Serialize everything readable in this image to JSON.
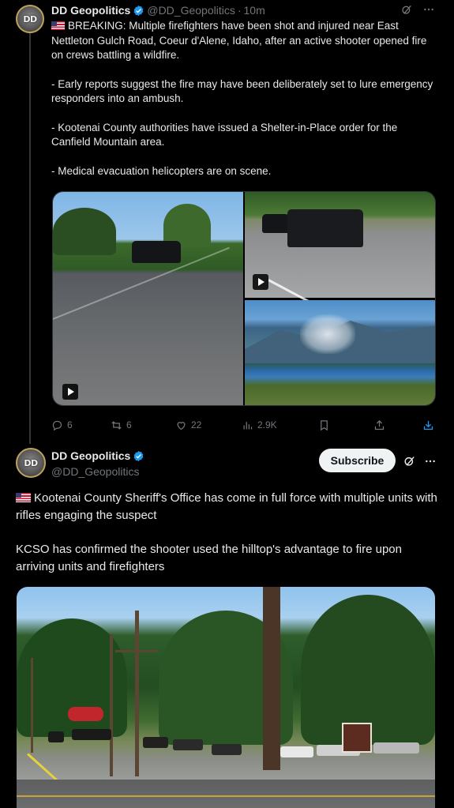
{
  "tweet1": {
    "avatar_text": "DD",
    "author_name": "DD Geopolitics",
    "handle": "@DD_Geopolitics",
    "separator": "·",
    "time": "10m",
    "paragraphs": [
      "BREAKING: Multiple firefighters have been shot and injured near East Nettleton Gulch Road, Coeur d'Alene, Idaho, after an active shooter opened fire on crews battling a wildfire.",
      "- Early reports suggest the fire may have been deliberately set to lure emergency responders into an ambush.",
      "- Kootenai County authorities have issued a Shelter-in-Place order for the Canfield Mountain area.",
      "- Medical evacuation helicopters are on scene."
    ],
    "actions": {
      "replies": "6",
      "reposts": "6",
      "likes": "22",
      "views": "2.9K"
    }
  },
  "tweet2": {
    "avatar_text": "DD",
    "author_name": "DD Geopolitics",
    "handle": "@DD_Geopolitics",
    "subscribe_label": "Subscribe",
    "paragraphs": [
      "Kootenai County Sheriff's Office has come in full force with multiple units with rifles engaging the suspect",
      "KCSO has confirmed the shooter used the hilltop's advantage to fire upon arriving units and firefighters"
    ]
  },
  "colors": {
    "background": "#000000",
    "text": "#e7e9ea",
    "muted": "#71767b",
    "verified": "#1d9bf0",
    "subscribe_bg": "#eff3f4"
  },
  "icons": [
    "verified-badge-icon",
    "grok-icon",
    "more-icon",
    "reply-icon",
    "repost-icon",
    "like-icon",
    "views-icon",
    "bookmark-icon",
    "share-icon",
    "download-icon",
    "play-icon",
    "us-flag-icon"
  ]
}
